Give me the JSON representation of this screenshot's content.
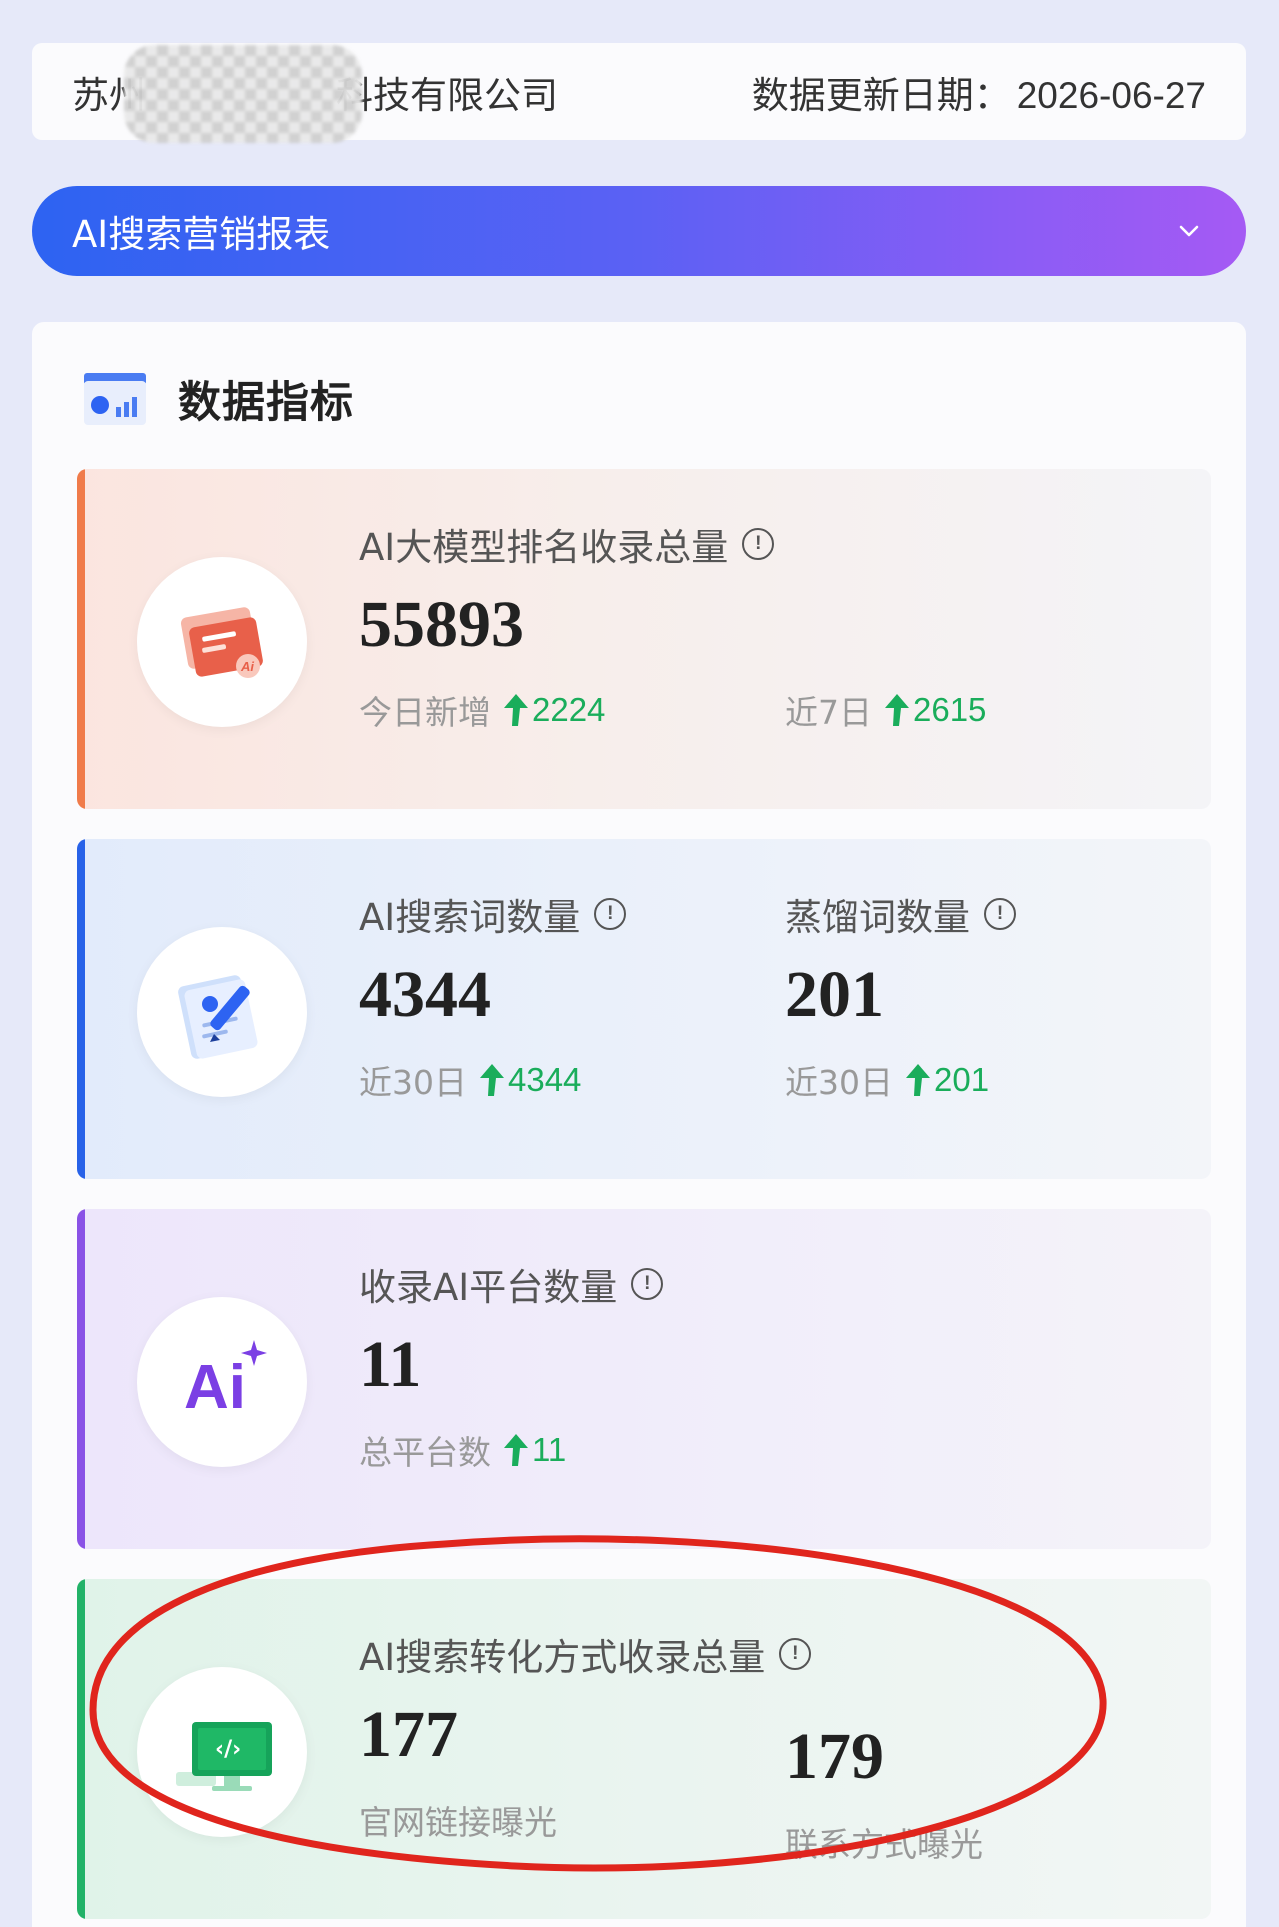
{
  "header": {
    "company_prefix": "苏州",
    "company_suffix": "科技有限公司",
    "update_label": "数据更新日期：",
    "update_date": "2026-06-27"
  },
  "report_select": {
    "label": "AI搜索营销报表"
  },
  "section": {
    "title": "数据指标"
  },
  "cards": [
    {
      "accent": "#f07b4a",
      "metrics": [
        {
          "label": "AI大模型排名收录总量",
          "value": "55893",
          "subs": [
            {
              "label": "今日新增",
              "delta": "2224"
            },
            {
              "label": "近7日",
              "delta": "2615"
            }
          ]
        }
      ]
    },
    {
      "accent": "#2862e8",
      "metrics": [
        {
          "label": "AI搜索词数量",
          "value": "4344",
          "subs": [
            {
              "label": "近30日",
              "delta": "4344"
            }
          ]
        },
        {
          "label": "蒸馏词数量",
          "value": "201",
          "subs": [
            {
              "label": "近30日",
              "delta": "201"
            }
          ]
        }
      ]
    },
    {
      "accent": "#8a52e6",
      "icon_text": "Ai",
      "metrics": [
        {
          "label": "收录AI平台数量",
          "value": "11",
          "subs": [
            {
              "label": "总平台数",
              "delta": "11"
            }
          ]
        }
      ]
    },
    {
      "accent": "#22b268",
      "icon_text": "‹/›",
      "metrics": [
        {
          "label": "AI搜索转化方式收录总量",
          "value": "177",
          "caption": "官网链接曝光"
        },
        {
          "value": "179",
          "caption": "联系方式曝光"
        }
      ]
    }
  ],
  "colors": {
    "up_green": "#1aad5b",
    "annotation_red": "#e0251d",
    "gradient_start": "#2d63f2",
    "gradient_end": "#a55af4"
  }
}
